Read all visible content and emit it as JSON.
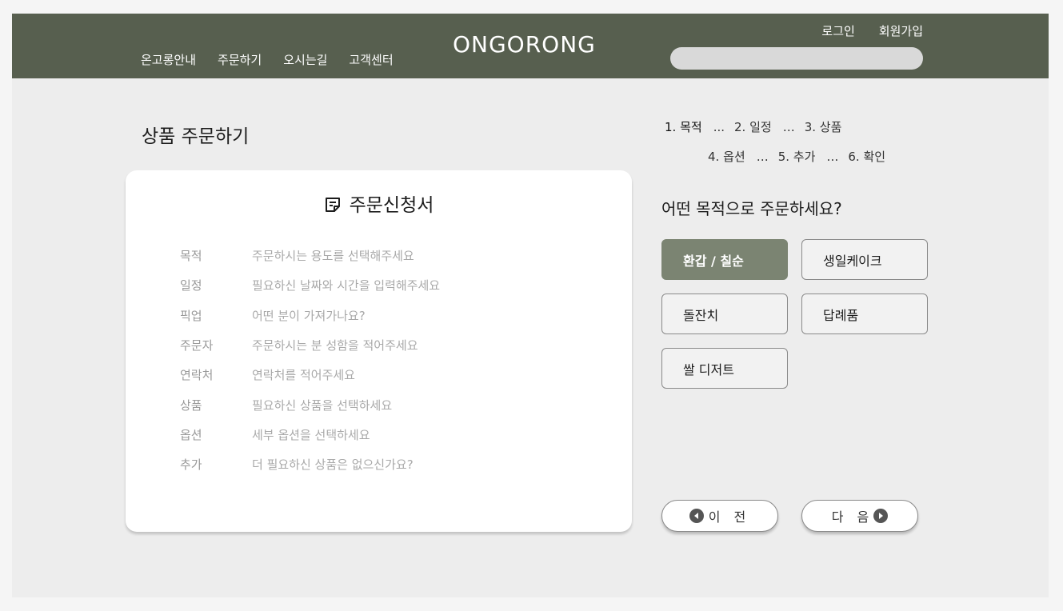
{
  "header": {
    "nav": [
      "온고롱안내",
      "주문하기",
      "오시는길",
      "고객센터"
    ],
    "logo": "ONGORONG",
    "login": "로그인",
    "signup": "회원가입",
    "search_placeholder": ""
  },
  "page": {
    "title": "상품 주문하기"
  },
  "card": {
    "title": "주문신청서",
    "rows": [
      {
        "label": "목적",
        "placeholder": "주문하시는 용도를 선택해주세요"
      },
      {
        "label": "일정",
        "placeholder": "필요하신 날짜와 시간을 입력해주세요"
      },
      {
        "label": "픽업",
        "placeholder": "어떤 분이 가져가나요?"
      },
      {
        "label": "주문자",
        "placeholder": "주문하시는 분 성함을 적어주세요"
      },
      {
        "label": "연락처",
        "placeholder": "연락처를 적어주세요"
      },
      {
        "label": "상품",
        "placeholder": "필요하신 상품을 선택하세요"
      },
      {
        "label": "옵션",
        "placeholder": "세부 옵션을 선택하세요"
      },
      {
        "label": "추가",
        "placeholder": "더 필요하신 상품은 없으신가요?"
      }
    ]
  },
  "steps": {
    "s1": "1. 목적",
    "s2": "2. 일정",
    "s3": "3. 상품",
    "s4": "4. 옵션",
    "s5": "5. 추가",
    "s6": "6. 확인",
    "sep": "...",
    "sep_small": "…"
  },
  "question": "어떤 목적으로 주문하세요?",
  "options": [
    "환갑 / 칠순",
    "생일케이크",
    "돌잔치",
    "답례품",
    "쌀 디저트"
  ],
  "selected_option": "환갑 / 칠순",
  "buttons": {
    "prev": "이 전",
    "next": "다 음"
  },
  "colors": {
    "header_bg": "#575f4f",
    "selected_bg": "#7b8472",
    "content_bg": "#ededed"
  }
}
